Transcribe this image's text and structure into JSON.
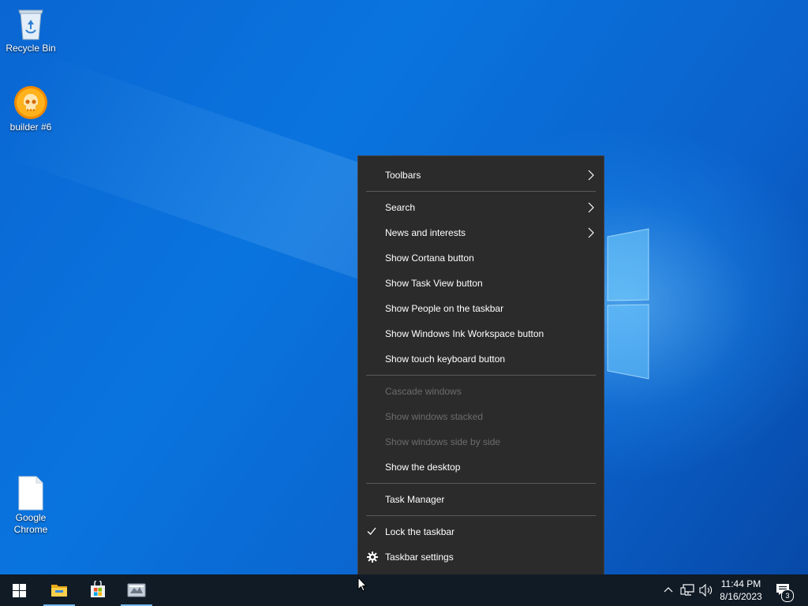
{
  "desktop": {
    "icons": [
      {
        "label": "Recycle Bin",
        "icon": "recycle-bin-icon"
      },
      {
        "label": "builder #6",
        "icon": "skull-icon"
      },
      {
        "label": "Google Chrome",
        "icon": "blank-file-icon"
      }
    ]
  },
  "context_menu": {
    "items": [
      {
        "label": "Toolbars",
        "has_submenu": true,
        "enabled": true
      },
      {
        "label": "Search",
        "has_submenu": true,
        "enabled": true
      },
      {
        "label": "News and interests",
        "has_submenu": true,
        "enabled": true
      },
      {
        "label": "Show Cortana button",
        "enabled": true
      },
      {
        "label": "Show Task View button",
        "enabled": true
      },
      {
        "label": "Show People on the taskbar",
        "enabled": true
      },
      {
        "label": "Show Windows Ink Workspace button",
        "enabled": true
      },
      {
        "label": "Show touch keyboard button",
        "enabled": true
      },
      {
        "label": "Cascade windows",
        "enabled": false
      },
      {
        "label": "Show windows stacked",
        "enabled": false
      },
      {
        "label": "Show windows side by side",
        "enabled": false
      },
      {
        "label": "Show the desktop",
        "enabled": true
      },
      {
        "label": "Task Manager",
        "enabled": true
      },
      {
        "label": "Lock the taskbar",
        "checked": true,
        "enabled": true
      },
      {
        "label": "Taskbar settings",
        "icon": "gear-icon",
        "enabled": true
      }
    ]
  },
  "taskbar": {
    "apps": [
      "start-icon",
      "file-explorer-icon",
      "microsoft-store-icon",
      "pinned-app-icon"
    ],
    "tray": {
      "time": "11:44 PM",
      "date": "8/16/2023",
      "notification_count": "3"
    }
  },
  "colors": {
    "menu_bg": "#2b2b2b",
    "menu_separator": "#5a5a5a",
    "disabled_text": "#6c6c6c",
    "taskbar_bg": "#101b26",
    "active_indicator": "#76b9ed",
    "desktop_blue": "#0a74de"
  }
}
